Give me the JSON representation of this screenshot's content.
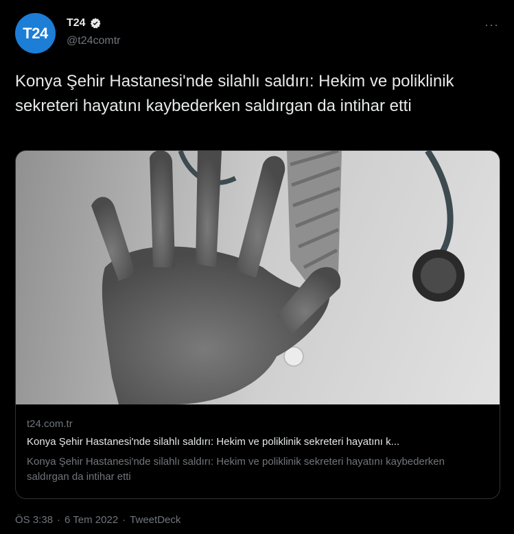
{
  "author": {
    "avatar_text": "T24",
    "display_name": "T24",
    "handle": "@t24comtr",
    "verified_icon": "verified-badge-icon"
  },
  "more_label": "···",
  "tweet": {
    "text": "Konya Şehir Hastanesi'nde silahlı saldırı: Hekim ve poliklinik sekreteri hayatını kaybederken saldırgan da intihar etti"
  },
  "card": {
    "domain": "t24.com.tr",
    "title": "Konya Şehir Hastanesi'nde silahlı saldırı: Hekim ve poliklinik sekreteri hayatını k...",
    "description": "Konya Şehir Hastanesi'nde silahlı saldırı: Hekim ve poliklinik sekreteri hayatını kaybederken saldırgan da intihar etti"
  },
  "meta": {
    "time": "ÖS 3:38",
    "sep1": "·",
    "date": "6 Tem 2022",
    "sep2": "·",
    "source": "TweetDeck"
  },
  "colors": {
    "background": "#000000",
    "text": "#e7e9ea",
    "secondary": "#71767b",
    "avatar": "#1c7ed6",
    "border": "#2f3336"
  }
}
